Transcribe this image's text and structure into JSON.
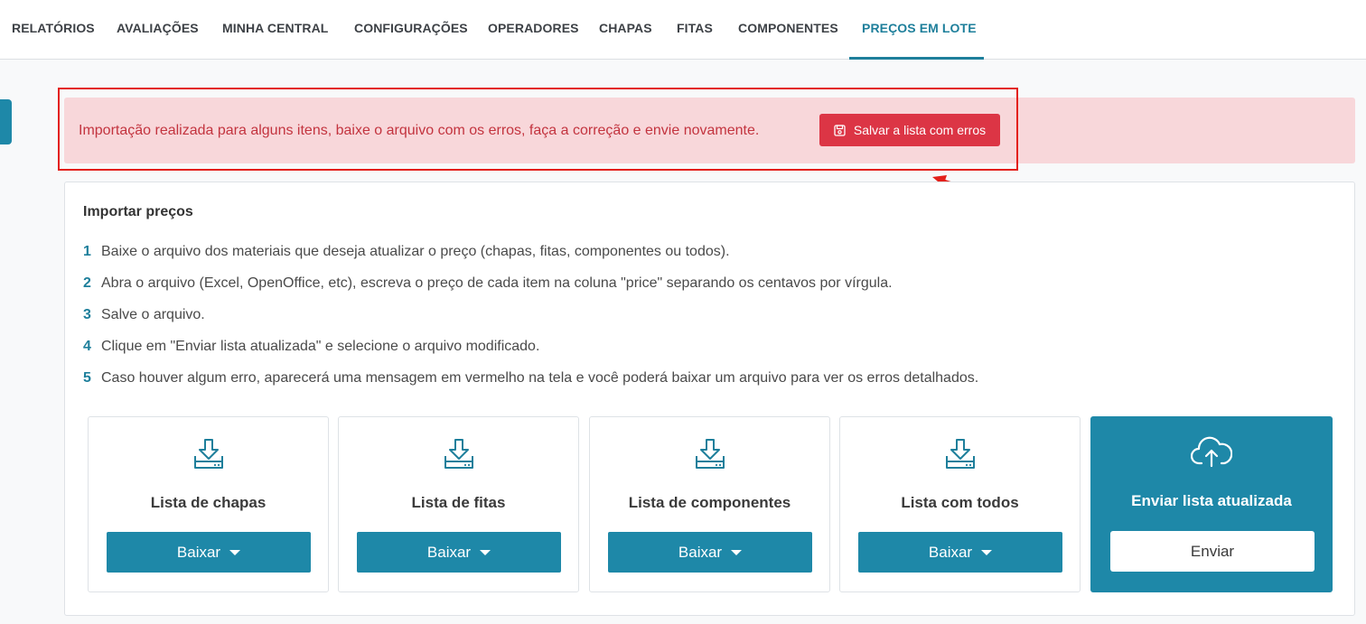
{
  "nav": {
    "tabs": [
      {
        "label": "RELATÓRIOS"
      },
      {
        "label": "AVALIAÇÕES"
      },
      {
        "label": "MINHA CENTRAL"
      },
      {
        "label": "CONFIGURAÇÕES"
      },
      {
        "label": "OPERADORES"
      },
      {
        "label": "CHAPAS"
      },
      {
        "label": "FITAS"
      },
      {
        "label": "COMPONENTES"
      },
      {
        "label": "PREÇOS EM LOTE",
        "active": true
      }
    ]
  },
  "alert": {
    "message": "Importação realizada para alguns itens, baixe o arquivo com os erros, faça a correção e envie novamente.",
    "button_label": "Salvar a lista com erros",
    "button_icon": "save-icon",
    "color_bg": "#f8d7da",
    "color_text": "#c3343f",
    "color_button": "#dc3545"
  },
  "import": {
    "title": "Importar preços",
    "steps": [
      {
        "num": "1",
        "text": "Baixe o arquivo dos materiais que deseja atualizar o preço (chapas, fitas, componentes ou todos)."
      },
      {
        "num": "2",
        "text": "Abra o arquivo (Excel, OpenOffice, etc), escreva o preço de cada item na coluna \"price\" separando os centavos por vírgula."
      },
      {
        "num": "3",
        "text": "Salve o arquivo."
      },
      {
        "num": "4",
        "text": "Clique em \"Enviar lista atualizada\" e selecione o arquivo modificado."
      },
      {
        "num": "5",
        "text": "Caso houver algum erro, aparecerá uma mensagem em vermelho na tela e você poderá baixar um arquivo para ver os erros detalhados."
      }
    ],
    "downloads": [
      {
        "title": "Lista de chapas",
        "button_label": "Baixar",
        "icon": "download-tray-icon"
      },
      {
        "title": "Lista de fitas",
        "button_label": "Baixar",
        "icon": "download-tray-icon"
      },
      {
        "title": "Lista de componentes",
        "button_label": "Baixar",
        "icon": "download-tray-icon"
      },
      {
        "title": "Lista com todos",
        "button_label": "Baixar",
        "icon": "download-tray-icon"
      }
    ],
    "upload": {
      "title": "Enviar lista atualizada",
      "button_label": "Enviar",
      "icon": "cloud-upload-icon"
    }
  },
  "colors": {
    "accent": "#1e88a8",
    "accent_text": "#1e7f9b",
    "annotation": "#e3201b"
  }
}
